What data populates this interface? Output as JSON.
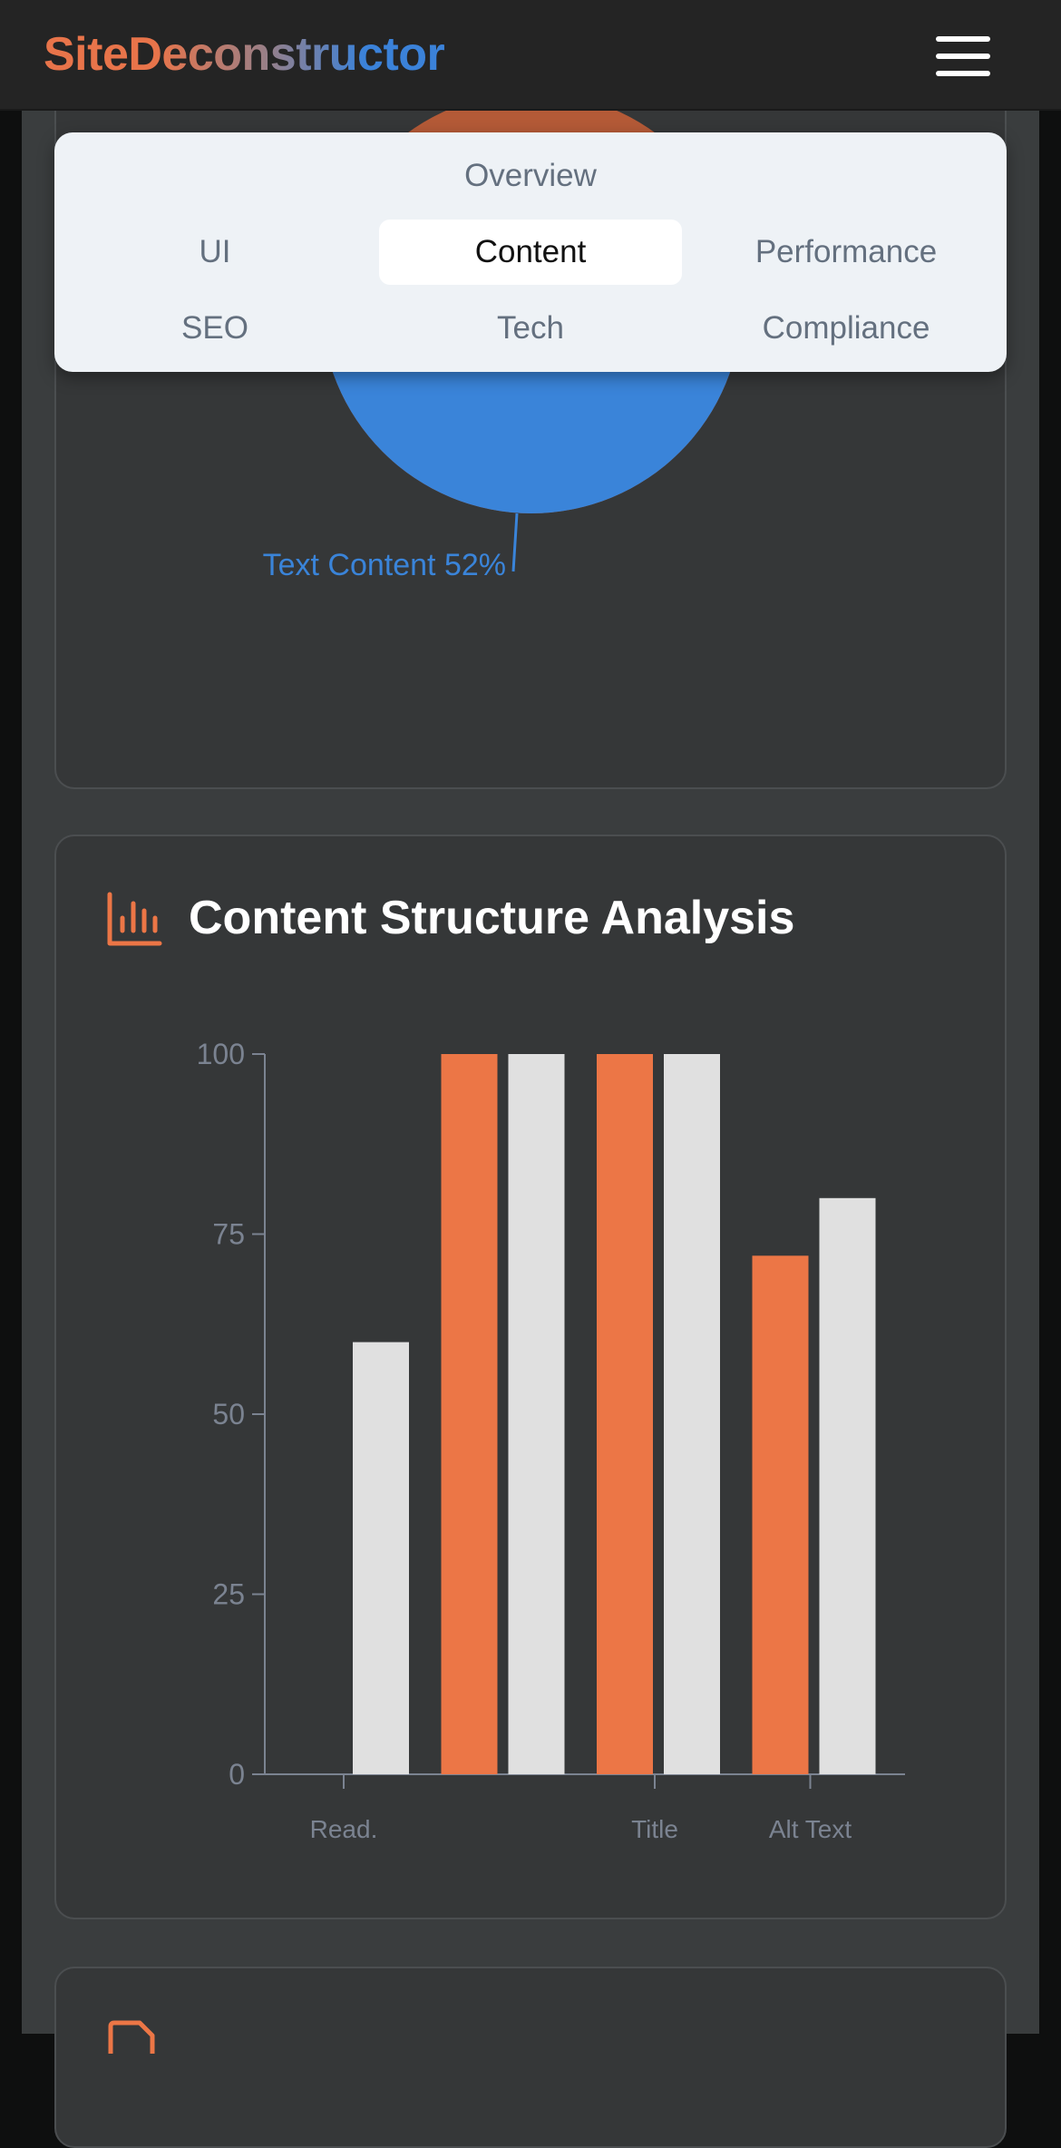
{
  "header": {
    "logo": "SiteDeconstructor",
    "menu_icon": "hamburger-menu-icon"
  },
  "nav": {
    "items": [
      {
        "label": "Overview",
        "active": false
      },
      {
        "label": "UI",
        "active": false
      },
      {
        "label": "Content",
        "active": true
      },
      {
        "label": "Performance",
        "active": false
      },
      {
        "label": "SEO",
        "active": false
      },
      {
        "label": "Tech",
        "active": false
      },
      {
        "label": "Compliance",
        "active": false
      }
    ]
  },
  "colors": {
    "orange": "#ec7646",
    "light": "#e0e0e0",
    "blue": "#3a84d9",
    "axis": "#7b8391"
  },
  "pie_card": {
    "slice_label": "Text Content 52%"
  },
  "structure_card": {
    "icon": "bar-chart-icon",
    "title": "Content Structure Analysis"
  },
  "chart_data": [
    {
      "type": "pie",
      "slices": [
        {
          "label": "Text Content",
          "percent": 52
        }
      ]
    },
    {
      "type": "bar",
      "categories": [
        "Read.",
        "",
        "Title",
        "Alt Text"
      ],
      "ylim": [
        0,
        100
      ],
      "yticks": [
        0,
        25,
        50,
        75,
        100
      ],
      "series": [
        {
          "values": [
            0,
            100,
            100,
            72
          ]
        },
        {
          "values": [
            60,
            100,
            100,
            80
          ]
        }
      ]
    }
  ],
  "next_card": {
    "icon": "document-icon"
  }
}
